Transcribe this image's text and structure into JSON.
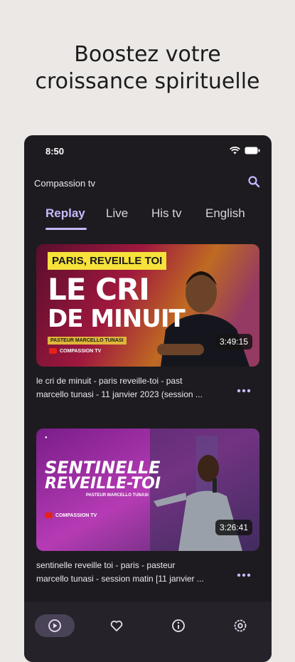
{
  "promo": {
    "line1": "Boostez votre",
    "line2": "croissance spirituelle"
  },
  "status_bar": {
    "time": "8:50"
  },
  "app": {
    "title": "Compassion tv"
  },
  "tabs": [
    {
      "label": "Replay",
      "active": true
    },
    {
      "label": "Live",
      "active": false
    },
    {
      "label": "His tv",
      "active": false
    },
    {
      "label": "English",
      "active": false
    }
  ],
  "videos": [
    {
      "title_line1": "le cri de minuit - paris reveille-toi - past",
      "title_line2": "marcello tunasi - 11 janvier 2023 (session ...",
      "duration": "3:49:15",
      "thumb_banner": "PARIS, REVEILLE TOI",
      "thumb_big1": "LE CRI",
      "thumb_big2": "DE MINUIT",
      "thumb_name": "PASTEUR MARCELLO TUNASI",
      "thumb_channel": "COMPASSION TV"
    },
    {
      "title_line1": "sentinelle reveille toi - paris - pasteur",
      "title_line2": "marcello tunasi  - session matin [11 janvier ...",
      "duration": "3:26:41",
      "thumb_big1": "SENTINELLE",
      "thumb_big2": "REVEILLE-TOI",
      "thumb_name": "PASTEUR MARCELLO TUNASI",
      "thumb_channel": "COMPASSION TV"
    }
  ],
  "icons": {
    "search": "search-icon",
    "more": "more-horizontal-icon",
    "nav": [
      "play-circle-icon",
      "heart-icon",
      "info-icon",
      "settings-icon"
    ]
  },
  "colors": {
    "accent": "#c8b9ff",
    "phone_bg": "#1d1b20",
    "page_bg": "#ebe8e5"
  }
}
